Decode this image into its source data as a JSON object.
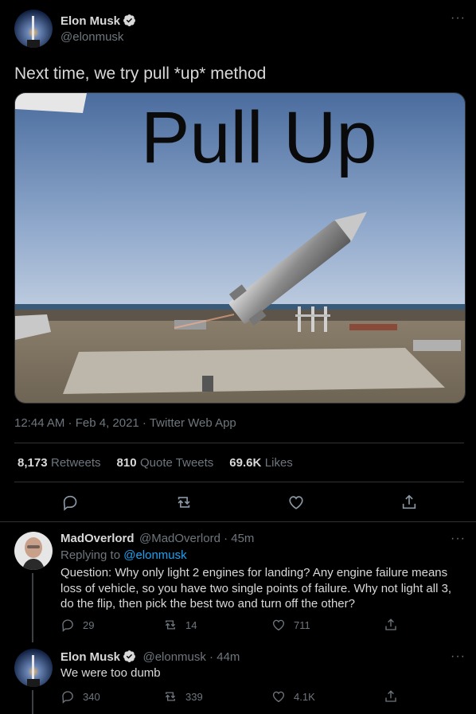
{
  "tweet": {
    "author_name": "Elon Musk",
    "author_handle": "@elonmusk",
    "more_icon": "more-dots-icon",
    "text": "Next time, we try pull *up* method",
    "image_caption": "Pull Up",
    "timestamp": "12:44 AM · Feb 4, 2021 · Twitter Web App",
    "stats": {
      "retweets_count": "8,173",
      "retweets_label": "Retweets",
      "quotes_count": "810",
      "quotes_label": "Quote Tweets",
      "likes_count": "69.6K",
      "likes_label": "Likes"
    },
    "actions": [
      "reply-icon",
      "retweet-icon",
      "like-icon",
      "share-icon"
    ]
  },
  "reply1": {
    "author_name": "MadOverlord",
    "author_handle_time": "@MadOverlord · 45m",
    "replying_prefix": "Replying to",
    "replying_to": "@elonmusk",
    "text": "Question: Why only light 2 engines for landing? Any engine failure means loss of vehicle, so you have two single points of failure. Why not light all 3, do the flip, then pick the best two and turn off the other?",
    "reply_count": "29",
    "retweet_count": "14",
    "like_count": "711"
  },
  "reply2": {
    "author_name": "Elon Musk",
    "author_handle_time": "@elonmusk · 44m",
    "text": "We were too dumb",
    "reply_count": "340",
    "retweet_count": "339",
    "like_count": "4.1K"
  },
  "colors": {
    "background": "#000000",
    "text": "#d9d9d9",
    "muted": "#6e767d",
    "link": "#1da1f2",
    "verified": "#d9d9d9"
  }
}
